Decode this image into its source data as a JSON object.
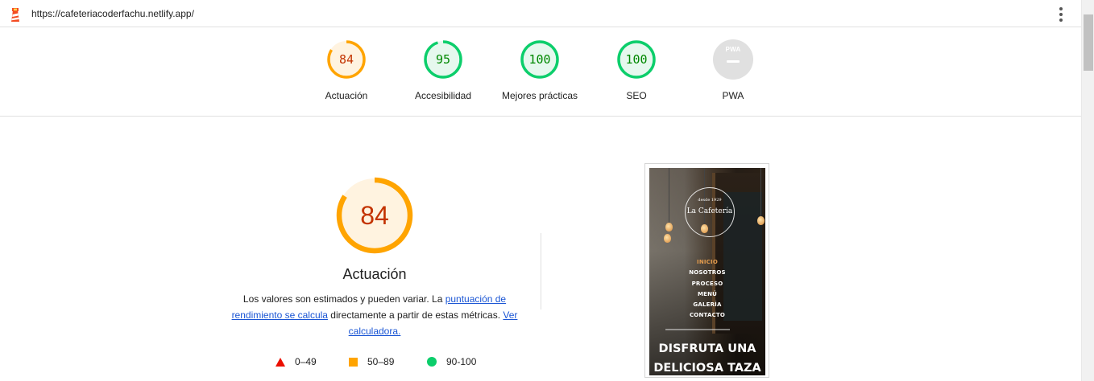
{
  "browser": {
    "url": "https://cafeteriacoderfachu.netlify.app/",
    "logo_icon": "lighthouse-icon",
    "menu_icon": "kebab-menu-icon"
  },
  "colors": {
    "fail": "#eb0f00",
    "average": "#ffa400",
    "pass": "#0cce6b",
    "average_text": "#c33300",
    "pass_text": "#008800",
    "link": "#1a55d4"
  },
  "gauges": [
    {
      "label": "Actuación",
      "score": "84",
      "level": "average"
    },
    {
      "label": "Accesibilidad",
      "score": "95",
      "level": "pass"
    },
    {
      "label": "Mejores prácticas",
      "score": "100",
      "level": "pass"
    },
    {
      "label": "SEO",
      "score": "100",
      "level": "pass"
    },
    {
      "label": "PWA",
      "score": "",
      "badge": "PWA",
      "level": "na"
    }
  ],
  "performance": {
    "score": "84",
    "title": "Actuación",
    "desc_before": "Los valores son estimados y pueden variar. La ",
    "desc_link1": "puntuación de rendimiento se calcula",
    "desc_middle": " directamente a partir de estas métricas. ",
    "desc_link2": "Ver calculadora."
  },
  "legend": [
    {
      "range": "0–49",
      "shape": "triangle"
    },
    {
      "range": "50–89",
      "shape": "square"
    },
    {
      "range": "90-100",
      "shape": "circle"
    }
  ],
  "thumbnail": {
    "logo_sub": "desde 1929",
    "logo_name": "La Cafetería",
    "nav": [
      "INICIO",
      "NOSOTROS",
      "PROCESO",
      "MENÚ",
      "GALERÍA",
      "CONTACTO"
    ],
    "hero_line1": "DISFRUTA UNA",
    "hero_line2": "DELICIOSA TAZA"
  }
}
